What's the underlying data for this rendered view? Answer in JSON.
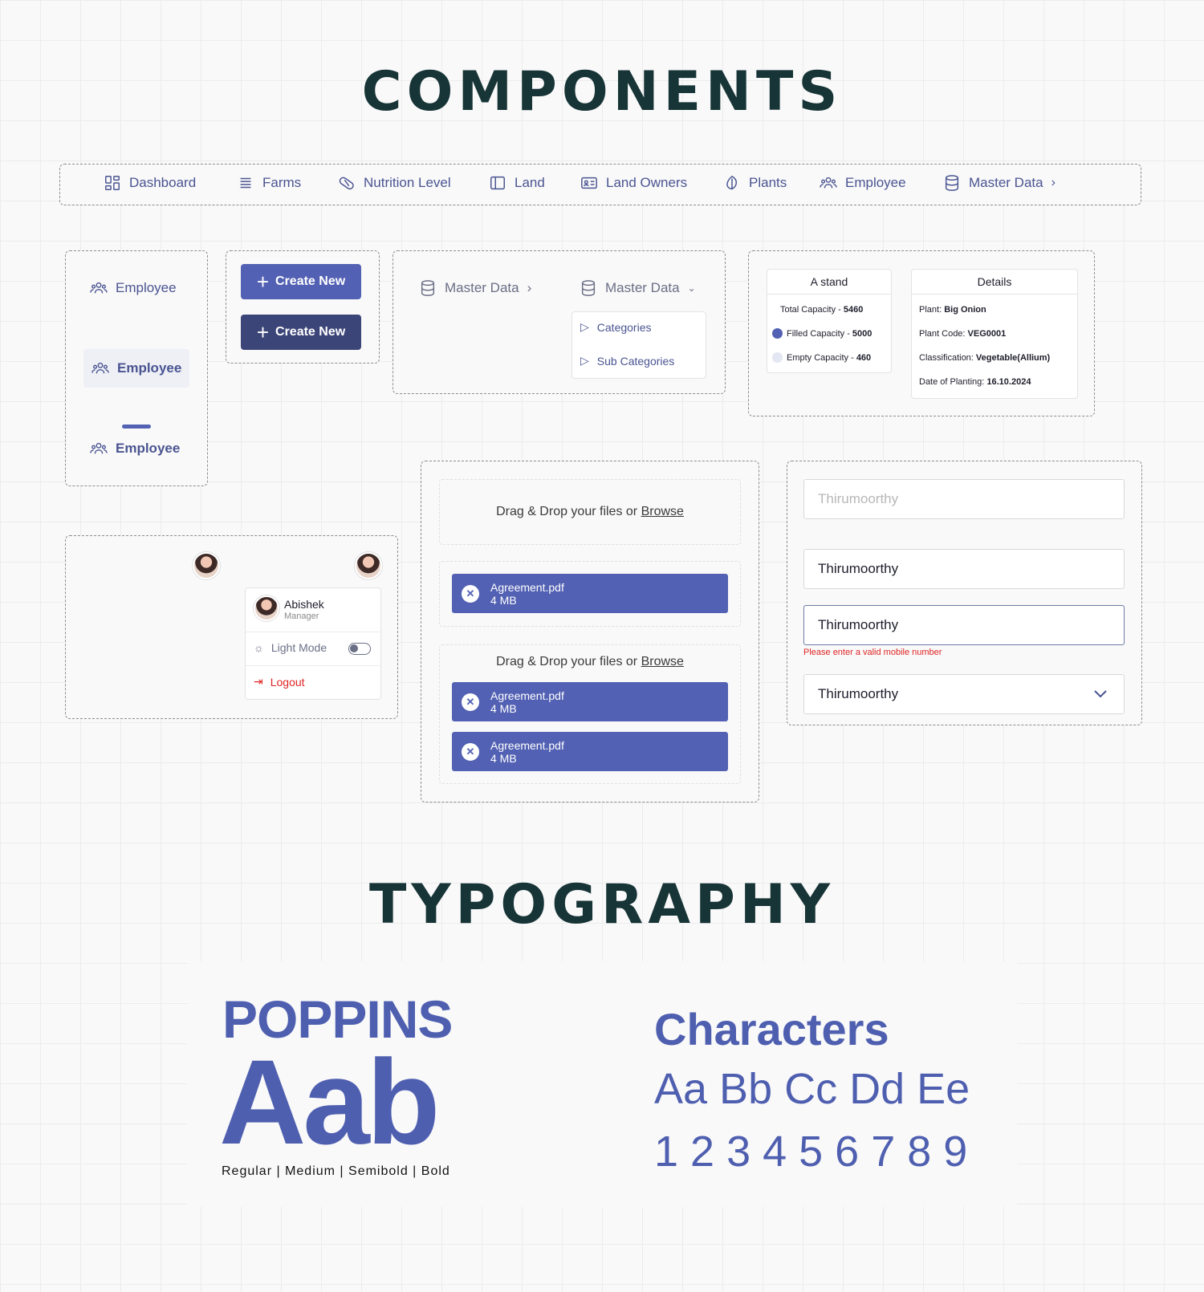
{
  "headings": {
    "components": "COMPONENTS",
    "typography": "TYPOGRAPHY"
  },
  "nav": {
    "items": [
      {
        "label": "Dashboard",
        "icon": "grid-icon"
      },
      {
        "label": "Farms",
        "icon": "list-icon"
      },
      {
        "label": "Nutrition Level",
        "icon": "pill-icon"
      },
      {
        "label": "Land",
        "icon": "book-icon"
      },
      {
        "label": "Land Owners",
        "icon": "id-card-icon"
      },
      {
        "label": "Plants",
        "icon": "leaf-icon"
      },
      {
        "label": "Employee",
        "icon": "users-icon"
      },
      {
        "label": "Master Data",
        "icon": "database-icon"
      }
    ]
  },
  "employee_states": {
    "label": "Employee"
  },
  "buttons": {
    "create_new": "Create New"
  },
  "master_data": {
    "label": "Master Data",
    "submenu": [
      "Categories",
      "Sub Categories"
    ]
  },
  "stand_card": {
    "title": "A stand",
    "rows": [
      {
        "label": "Total Capacity - ",
        "value": "5460"
      },
      {
        "label": "Filled Capacity - ",
        "value": "5000"
      },
      {
        "label": "Empty Capacity - ",
        "value": "460"
      }
    ],
    "colors": {
      "filled": "#5261b3",
      "empty": "#e3e6f3"
    }
  },
  "details_card": {
    "title": "Details",
    "rows": [
      {
        "label": "Plant: ",
        "value": "Big Onion"
      },
      {
        "label": "Plant Code: ",
        "value": "VEG0001"
      },
      {
        "label": "Classification: ",
        "value": "Vegetable(Allium)"
      },
      {
        "label": "Date of Planting: ",
        "value": "16.10.2024"
      }
    ]
  },
  "profile": {
    "name": "Abishek",
    "role": "Manager",
    "light_mode": "Light Mode",
    "logout": "Logout"
  },
  "upload": {
    "prompt": "Drag & Drop your files or ",
    "browse": "Browse",
    "file_name": "Agreement.pdf",
    "file_size": "4 MB"
  },
  "inputs": {
    "value": "Thirumoorthy",
    "error": "Please enter a valid mobile number"
  },
  "typography": {
    "font_name": "POPPINS",
    "sample": "Aab",
    "weights": "Regular | Medium | Semibold | Bold",
    "characters_title": "Characters",
    "letters": "Aa Bb Cc Dd Ee",
    "digits": "1 2 3 4 5 6 7 8 9"
  },
  "colors": {
    "primary": "#5261b3",
    "primary_dark": "#3c4578",
    "heading": "#173437",
    "error": "#e02424"
  }
}
